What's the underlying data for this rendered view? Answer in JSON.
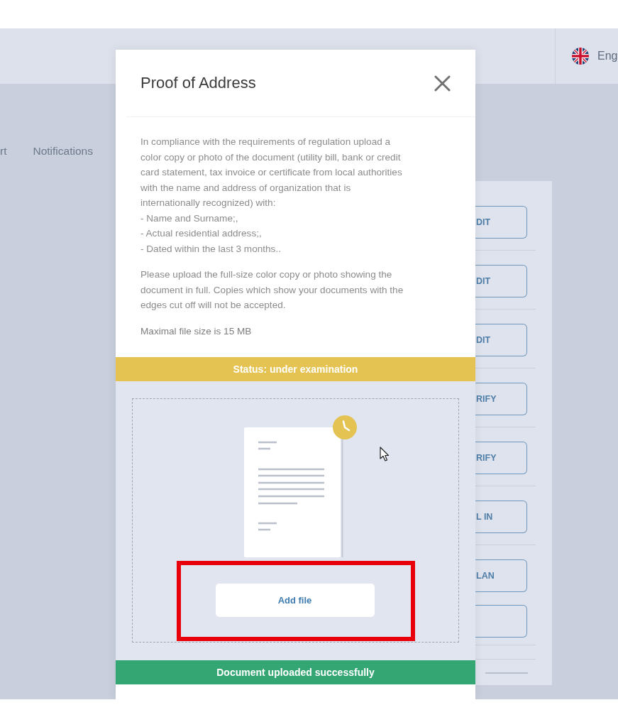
{
  "header": {
    "language": "Eng"
  },
  "nav": {
    "items": [
      {
        "label": "rt"
      },
      {
        "label": "Notifications"
      }
    ]
  },
  "side_panel": {
    "buttons": [
      {
        "kind": "text",
        "label": "DIT"
      },
      {
        "kind": "text",
        "label": "DIT"
      },
      {
        "kind": "text",
        "label": "DIT"
      },
      {
        "kind": "text",
        "label": "RIFY"
      },
      {
        "kind": "text",
        "label": "RIFY"
      },
      {
        "kind": "text",
        "label": "L IN"
      },
      {
        "kind": "text",
        "label": "LAN"
      },
      {
        "kind": "blank"
      }
    ]
  },
  "modal": {
    "title": "Proof of Address",
    "intro": "In compliance with the requirements of regulation upload a\ncolor copy or photo of the document (utility bill, bank or credit\ncard statement, tax invoice or certificate from local authorities\nwith the name and address of organization that is\ninternationally recognized) with:",
    "requirements": [
      "- Name and Surname;,",
      "- Actual residential address;,",
      "- Dated within the last 3 months.."
    ],
    "note": "Please upload the full-size color copy or photo showing the\ndocument in full. Copies which show your documents with the\nedges cut off will not be accepted.",
    "max_size": "Maximal file size is 15 MB",
    "status": {
      "kind": "pending",
      "text": "Status: under examination"
    },
    "add_file_button": "Add file",
    "notice": {
      "kind": "success",
      "text": "Document uploaded successfully"
    }
  }
}
